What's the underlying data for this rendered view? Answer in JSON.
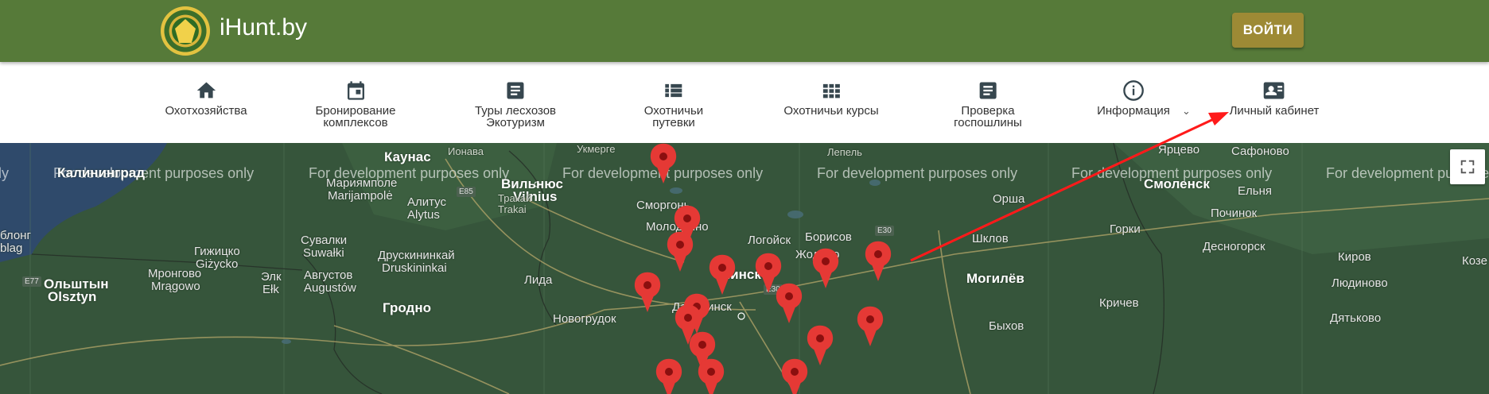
{
  "header": {
    "brand": "iHunt.by",
    "login_label": "ВОЙТИ"
  },
  "nav": {
    "items": [
      {
        "id": "hunting-grounds",
        "lines": [
          "Охотхозяйства",
          ""
        ],
        "icon": "home-icon"
      },
      {
        "id": "booking",
        "lines": [
          "Бронирование",
          "комплексов"
        ],
        "icon": "calendar-icon"
      },
      {
        "id": "tours",
        "lines": [
          "Туры лесхозов",
          "Экотуризм"
        ],
        "icon": "document-icon"
      },
      {
        "id": "vouchers",
        "lines": [
          "Охотничьи",
          "путевки"
        ],
        "icon": "list-icon"
      },
      {
        "id": "courses",
        "lines": [
          "Охотничьи курсы",
          ""
        ],
        "icon": "grid-icon"
      },
      {
        "id": "fee-check",
        "lines": [
          "Проверка",
          "госпошлины"
        ],
        "icon": "document-icon"
      },
      {
        "id": "info",
        "lines": [
          "Информация",
          ""
        ],
        "icon": "info-icon"
      },
      {
        "id": "cabinet",
        "lines": [
          "Личный кабинет",
          ""
        ],
        "icon": "id-card-icon"
      }
    ],
    "info_chevron": "⌄"
  },
  "map": {
    "watermark": "For development purposes only",
    "watermark_partial_left": "ly",
    "cities": {
      "kaunas": "Каунас",
      "kalinigrad": "Калининград",
      "vilnius_ru": "Вильнюс",
      "vilnius_lt": "Vilnius",
      "marijampole_ru": "Мариямполе",
      "marijampole_lt": "Marijampolė",
      "alytus_ru": "Алитус",
      "alytus_lt": "Alytus",
      "trakai_ru": "Тракай",
      "trakai_lt": "Trakai",
      "suvalki_ru": "Сувалки",
      "suvalki_pl": "Suwałki",
      "druskininkai_ru": "Друскининкай",
      "druskininkai_lt": "Druskininkai",
      "gizycko_ru": "Гижицко",
      "gizycko_pl": "Giżycko",
      "mragowo_ru": "Мронгово",
      "mragowo_pl": "Mrągowo",
      "olsztyn_ru": "Ольштын",
      "olsztyn_pl": "Olsztyn",
      "augustow_ru": "Августов",
      "augustow_pl": "Augustów",
      "elk_ru": "Элк",
      "elk_pl": "Ełk",
      "blong": "блонг",
      "blag": "blag",
      "smorgon": "Сморгонь",
      "molodechno": "Молодечно",
      "lida": "Лида",
      "grodno": "Гродно",
      "novogrudok": "Новогрудок",
      "dzerzhinsk": "Дзержинск",
      "minsk": "Минск",
      "logoisk": "Логойск",
      "borisov": "Борисов",
      "zhodino": "Жодино",
      "lepel": "Лепель",
      "orsha": "Орша",
      "shklov": "Шклов",
      "mogilev": "Могилёв",
      "bykhov": "Быхов",
      "krichev": "Кричев",
      "gorki": "Горки",
      "smolensk": "Смоленск",
      "yartsevo": "Ярцево",
      "safonovo": "Сафоново",
      "yelnya": "Ельня",
      "pochinok": "Починок",
      "desnogorsk": "Десногорск",
      "kirov": "Киров",
      "lyudinovo": "Людиново",
      "dyatkovo": "Дятьково",
      "kozelsk": "Козе",
      "ionava": "Ионава",
      "ukmerge": "Укмерге"
    },
    "roads": [
      "E85",
      "E77",
      "E30",
      "E30"
    ]
  },
  "colors": {
    "header": "#567a39",
    "login": "#9d8a35",
    "marker": "#e53935",
    "arrow": "#ff1a1a"
  }
}
